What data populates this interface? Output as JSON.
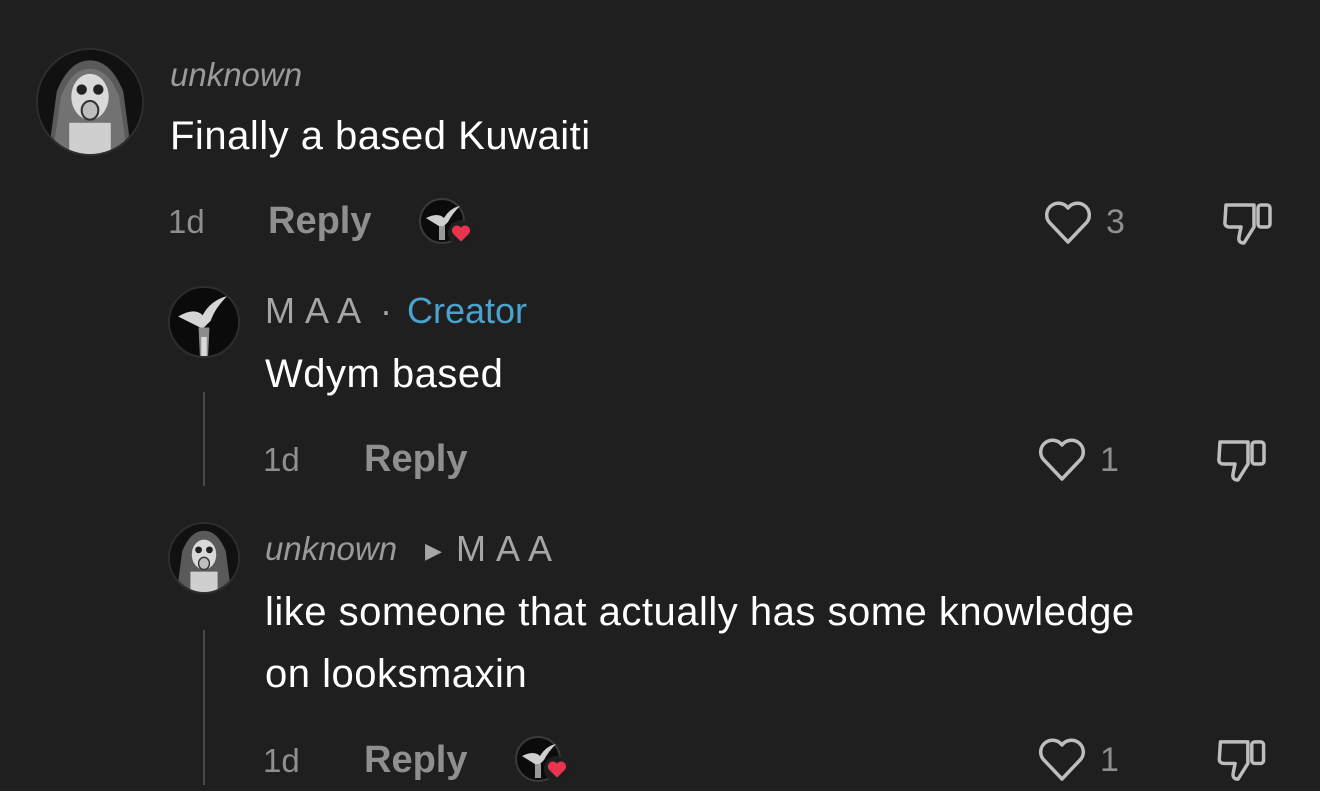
{
  "comments": [
    {
      "username": "unknown",
      "text": "Finally a based Kuwaiti",
      "time": "1d",
      "reply_label": "Reply",
      "likes": "3",
      "creator_liked": true,
      "avatar_icon": "gas-mask-avatar"
    },
    {
      "username": "M A A",
      "separator": "·",
      "badge": "Creator",
      "text": "Wdym based",
      "time": "1d",
      "reply_label": "Reply",
      "likes": "1",
      "creator_liked": false,
      "avatar_icon": "bird-avatar"
    },
    {
      "username": "unknown",
      "reply_to": "M A A",
      "text_line1": "like someone that actually has some knowledge",
      "text_line2": "on looksmaxin",
      "time": "1d",
      "reply_label": "Reply",
      "likes": "1",
      "creator_liked": true,
      "avatar_icon": "gas-mask-avatar"
    }
  ],
  "colors": {
    "background": "#1f1f1f",
    "creator_badge": "#4aa3cf",
    "heart_badge": "#e8344e"
  }
}
